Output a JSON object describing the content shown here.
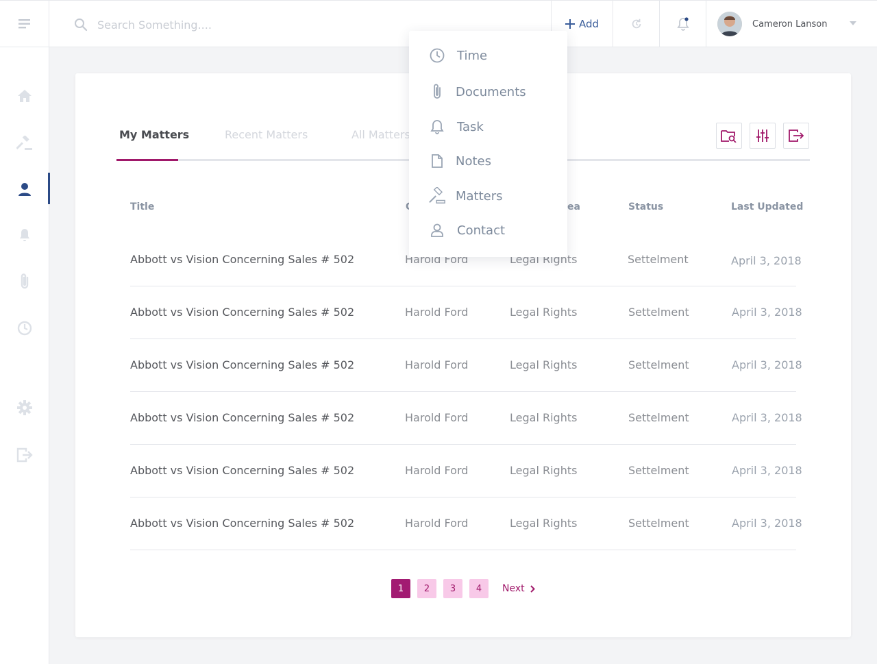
{
  "search": {
    "placeholder": "Search Something...."
  },
  "header": {
    "add_label": "Add",
    "user_name": "Cameron Lanson"
  },
  "sidebar": {
    "items": [
      {
        "icon": "home-icon"
      },
      {
        "icon": "gavel-icon"
      },
      {
        "icon": "user-icon",
        "active": true
      },
      {
        "icon": "bell-icon"
      },
      {
        "icon": "paperclip-icon"
      },
      {
        "icon": "clock-icon"
      },
      {
        "icon": "gear-icon"
      },
      {
        "icon": "logout-icon"
      }
    ]
  },
  "tabs": [
    {
      "label": "My Matters",
      "active": true
    },
    {
      "label": "Recent Matters"
    },
    {
      "label": "All Matters"
    }
  ],
  "table": {
    "columns": [
      "Title",
      "C",
      "ea",
      "Status",
      "Last Updated"
    ],
    "rows": [
      [
        "Abbott vs Vision Concerning Sales # 502",
        "Harold Ford",
        "Legal Rights",
        "Settelment",
        "April 3, 2018"
      ],
      [
        "Abbott vs Vision Concerning Sales # 502",
        "Harold Ford",
        "Legal Rights",
        "Settelment",
        "April 3, 2018"
      ],
      [
        "Abbott vs Vision Concerning Sales # 502",
        "Harold Ford",
        "Legal Rights",
        "Settelment",
        "April 3, 2018"
      ],
      [
        "Abbott vs Vision Concerning Sales # 502",
        "Harold Ford",
        "Legal Rights",
        "Settelment",
        "April 3, 2018"
      ],
      [
        "Abbott vs Vision Concerning Sales # 502",
        "Harold Ford",
        "Legal Rights",
        "Settelment",
        "April 3, 2018"
      ],
      [
        "Abbott vs Vision Concerning Sales # 502",
        "Harold Ford",
        "Legal Rights",
        "Settelment",
        "April 3, 2018"
      ]
    ]
  },
  "pagination": {
    "pages": [
      "1",
      "2",
      "3",
      "4"
    ],
    "current": "1",
    "next_label": "Next"
  },
  "add_menu": {
    "items": [
      {
        "label": "Time",
        "icon": "clock-icon"
      },
      {
        "label": "Documents",
        "icon": "paperclip-icon"
      },
      {
        "label": "Task",
        "icon": "bell-icon"
      },
      {
        "label": "Notes",
        "icon": "note-icon"
      },
      {
        "label": "Matters",
        "icon": "gavel-icon"
      },
      {
        "label": "Contact",
        "icon": "user-icon"
      }
    ]
  },
  "colors": {
    "accent": "#a0186a",
    "primary": "#2b4a86",
    "sidebar_icon": "#dde1e7"
  }
}
